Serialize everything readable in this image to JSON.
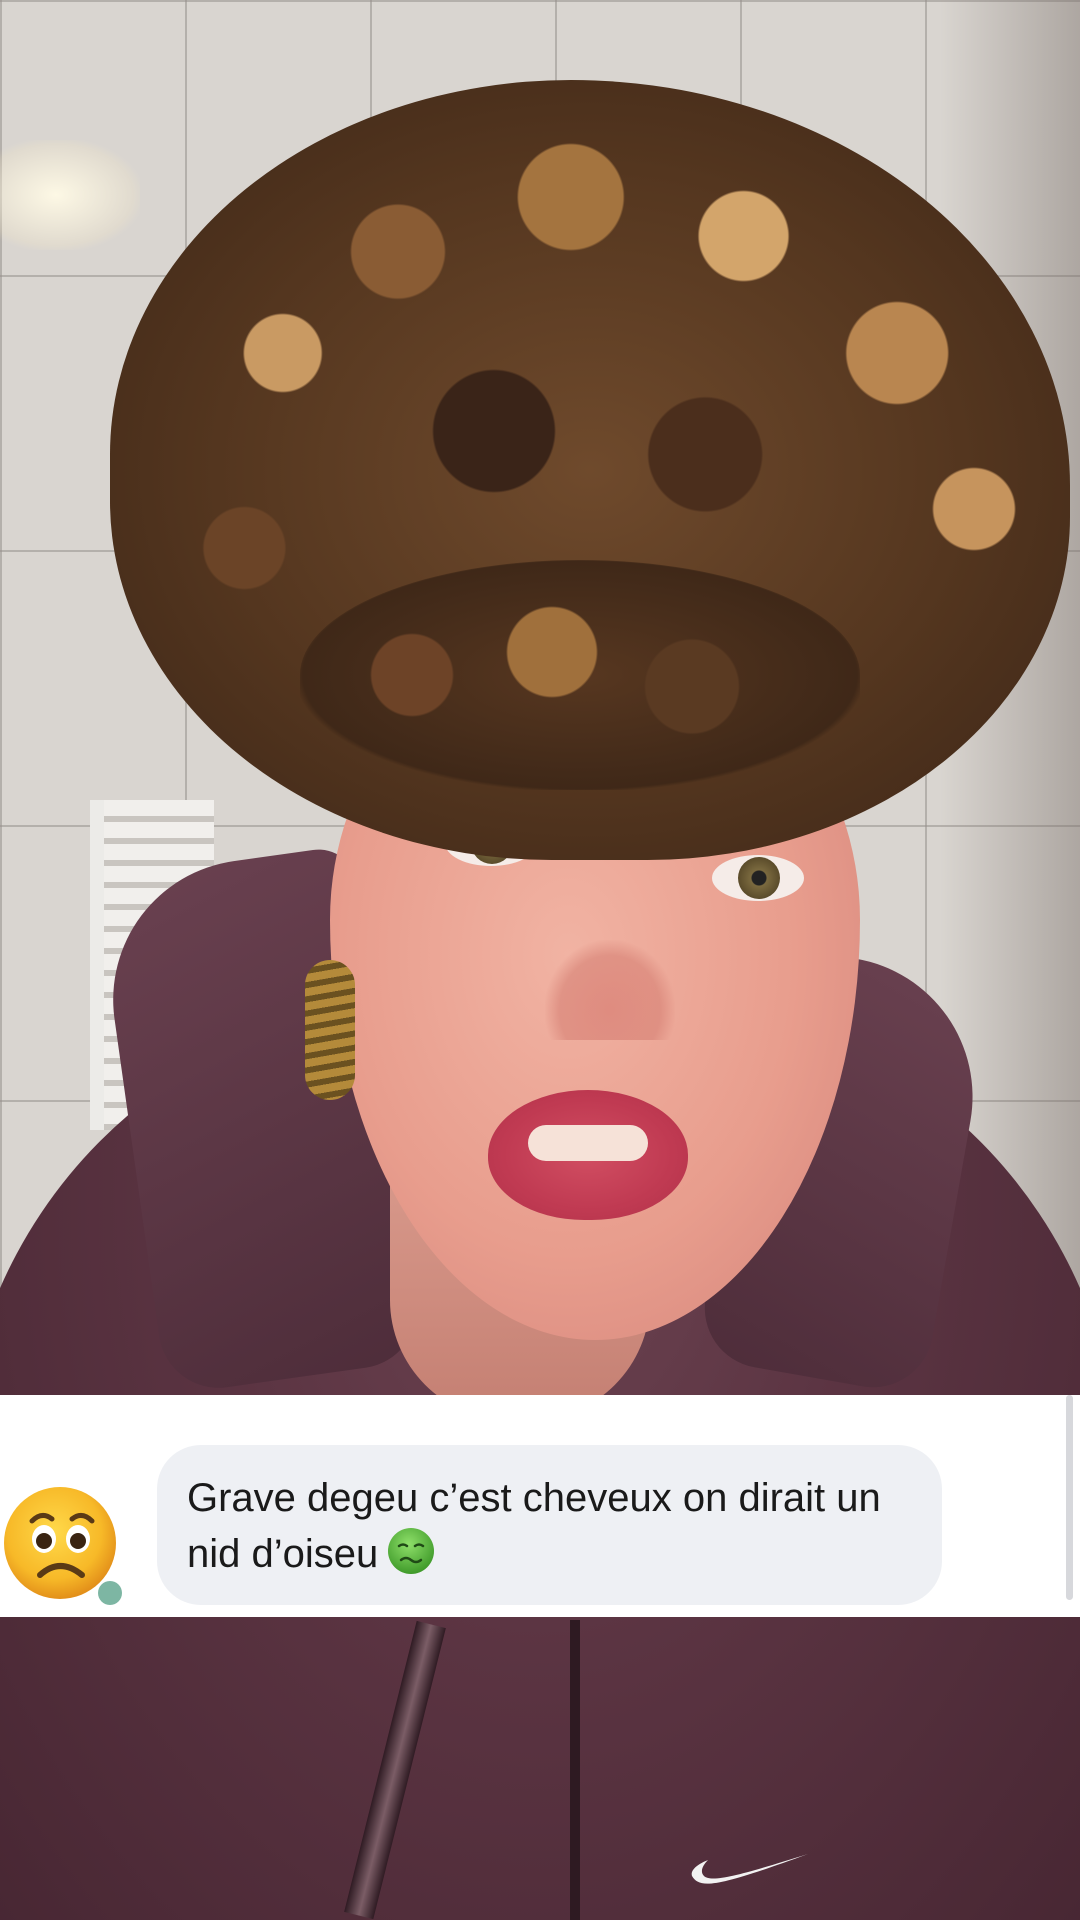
{
  "comment_reply": {
    "text": "Grave degeu c’est cheveux on dirait un nid d’oiseu",
    "emoji": "nauseated-face-icon",
    "avatar_emoji": "worried-face-icon"
  },
  "video": {
    "subject": "woman-with-curly-hair-in-hoodie"
  },
  "colors": {
    "hoodie": "#5b3442",
    "bubble": "#eef0f4",
    "card": "#ffffff",
    "emoji_green": "#5fbf3a",
    "emoji_yellow": "#f7b928"
  }
}
